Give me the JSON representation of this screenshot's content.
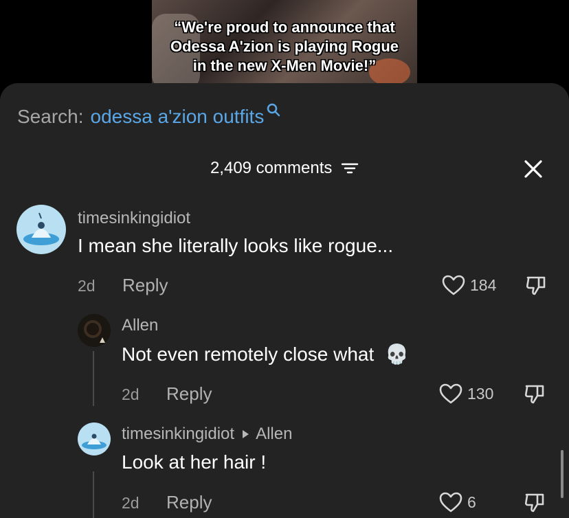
{
  "video": {
    "caption": "“We're proud to announce that\nOdessa A'zion is playing Rogue\nin the new X-Men Movie!”"
  },
  "search": {
    "label": "Search:",
    "term": "odessa a'zion outfits"
  },
  "header": {
    "comment_count": "2,409 comments"
  },
  "comments": [
    {
      "username": "timesinkingidiot",
      "text": "I mean she literally looks like rogue...",
      "time": "2d",
      "reply_label": "Reply",
      "likes": "184"
    },
    {
      "username": "Allen",
      "text": "Not even remotely close what",
      "emoji": "💀",
      "time": "2d",
      "reply_label": "Reply",
      "likes": "130"
    },
    {
      "username": "timesinkingidiot",
      "reply_to": "Allen",
      "text": "Look at her hair !",
      "time": "2d",
      "reply_label": "Reply",
      "likes": "6"
    }
  ],
  "colors": {
    "sheet_bg": "#232323",
    "search_term": "#5aa7e8",
    "avatar_bg": "#b9e0f2"
  }
}
